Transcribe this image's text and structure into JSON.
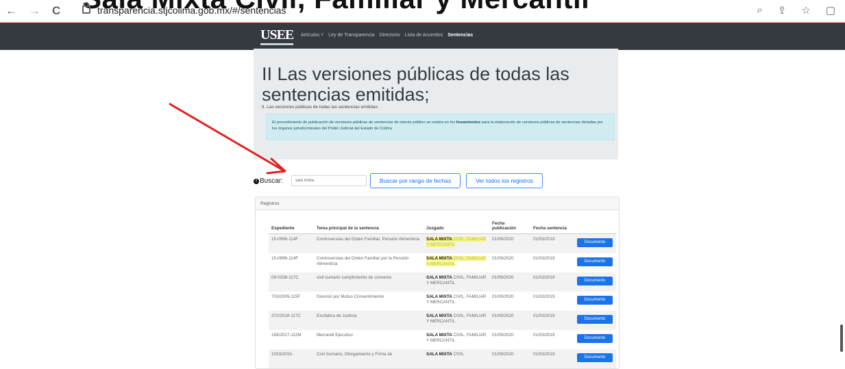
{
  "overlay_title": "Sala Mixta Civil, Familiar y Mercantil",
  "browser": {
    "back": "←",
    "forward": "→",
    "reload": "C",
    "url": "transparencia.stjcolima.gob.mx/#/sentencias",
    "icons": [
      "⌕",
      "⇪",
      "☆",
      "▢"
    ]
  },
  "navbar": {
    "logo": "USEE",
    "links": [
      "Artículos ˅",
      "Ley de Transparencia",
      "Directorio",
      "Lista de Acuerdos",
      "Sentencias"
    ]
  },
  "jumbotron": {
    "title": "II Las versiones públicas de todas las sentencias emitidas;",
    "subtitle": "II. Las versiones públicas de todas las sentencias emitidas:",
    "info_prefix": "El procedimiento de publicación de versiones públicas de sentencias de interés público se realiza en los",
    "info_bold": "lineamientos",
    "info_suffix": "para la elaboración de versiones públicas de sentencias dictadas por los órganos jurisdiccionales del Poder Judicial del Estado de Colima"
  },
  "search": {
    "label": "Buscar:",
    "value": "sala mixta",
    "btn_range": "Buscar por rango de fechas",
    "btn_all": "Ver todos los registros"
  },
  "card": {
    "header": "Registros",
    "columns": [
      "Expediente",
      "Tema principal de la sentencia",
      "Juzgado",
      "Fecha publicación",
      "Fecha sentencia",
      ""
    ],
    "rows": [
      {
        "exp": "15-0996-114F",
        "tema": "Controversias del Orden Familiar, Pensión Alimenticia",
        "juz_bold": "SALA MIXTA",
        "juz_rest": "CIVIL, FAMILIAR Y MERCANTIL",
        "pub": "01/09/2020",
        "sent": "01/03/2019",
        "btn": "Documento",
        "highlight": true
      },
      {
        "exp": "15-0996-114F",
        "tema": "Controversias del Orden Familiar por la Pensión Alimenticia",
        "juz_bold": "SALA MIXTA",
        "juz_rest": "CIVIL, FAMILIAR Y MERCANTIL",
        "pub": "01/09/2020",
        "sent": "01/03/2019",
        "btn": "Documento",
        "highlight": true
      },
      {
        "exp": "09-0338-117C",
        "tema": "civil sumario cumplimiento de convenio",
        "juz_bold": "SALA MIXTA",
        "juz_rest": "CIVIL, FAMILIAR Y MERCANTIL",
        "pub": "01/09/2020",
        "sent": "01/03/2019",
        "btn": "Documento",
        "highlight": false
      },
      {
        "exp": "703/2009-115F",
        "tema": "Divorcio por Mutuo Consentimiento",
        "juz_bold": "SALA MIXTA",
        "juz_rest": "CIVIL, FAMILIAR Y MERCANTIL",
        "pub": "01/09/2020",
        "sent": "01/03/2019",
        "btn": "Documento",
        "highlight": false
      },
      {
        "exp": "372/2018-117C",
        "tema": "Excitativa de Justicia",
        "juz_bold": "SALA MIXTA",
        "juz_rest": "CIVIL, FAMILIAR Y MERCANTIL",
        "pub": "01/09/2020",
        "sent": "01/03/2019",
        "btn": "Documento",
        "highlight": false
      },
      {
        "exp": "169/2017-112M",
        "tema": "Mercantil Ejecutivo",
        "juz_bold": "SALA MIXTA",
        "juz_rest": "CIVIL, FAMILIAR Y MERCANTIL",
        "pub": "01/09/2020",
        "sent": "01/03/2019",
        "btn": "Documento",
        "highlight": false
      },
      {
        "exp": "1033/2015-",
        "tema": "Civil Sumario, Otorgamiento y Firma de",
        "juz_bold": "SALA MIXTA",
        "juz_rest": "CIVIL",
        "pub": "01/09/2020",
        "sent": "01/03/2019",
        "btn": "Documento",
        "highlight": false
      }
    ]
  },
  "colors": {
    "navbar": "#343a40",
    "accent": "#0d6efd",
    "arrow": "#e02020",
    "highlight": "#f5f581"
  }
}
